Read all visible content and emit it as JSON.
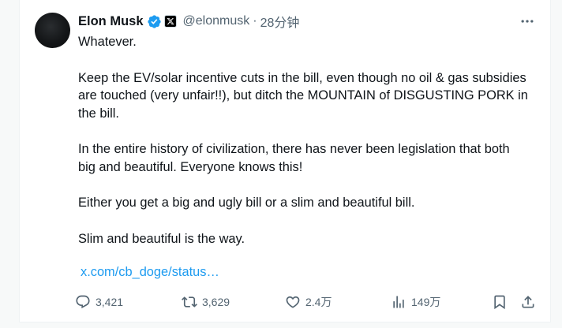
{
  "tweet": {
    "author_name": "Elon Musk",
    "handle": "@elonmusk",
    "separator": "·",
    "time": "28分钟",
    "paragraphs": [
      "Whatever.",
      "Keep the EV/solar incentive cuts in the bill, even though no oil & gas subsidies are touched (very unfair!!), but ditch the MOUNTAIN of DISGUSTING PORK in the bill.",
      "In the entire history of civilization, there has never been legislation that both big and beautiful. Everyone knows this!",
      "Either you get a big and ugly bill or a slim and beautiful bill.",
      "Slim and beautiful is the way."
    ],
    "link_text": "x.com/cb_doge/status…"
  },
  "actions": {
    "replies": "3,421",
    "reposts": "3,629",
    "likes": "2.4万",
    "views": "149万"
  },
  "colors": {
    "text": "#0f1419",
    "muted": "#536471",
    "link": "#1d9bf0",
    "verified": "#1d9bf0"
  },
  "icons": [
    "avatar",
    "verified-badge-icon",
    "x-affiliate-icon",
    "more-icon",
    "reply-icon",
    "repost-icon",
    "like-icon",
    "views-icon",
    "bookmark-icon",
    "share-icon"
  ]
}
